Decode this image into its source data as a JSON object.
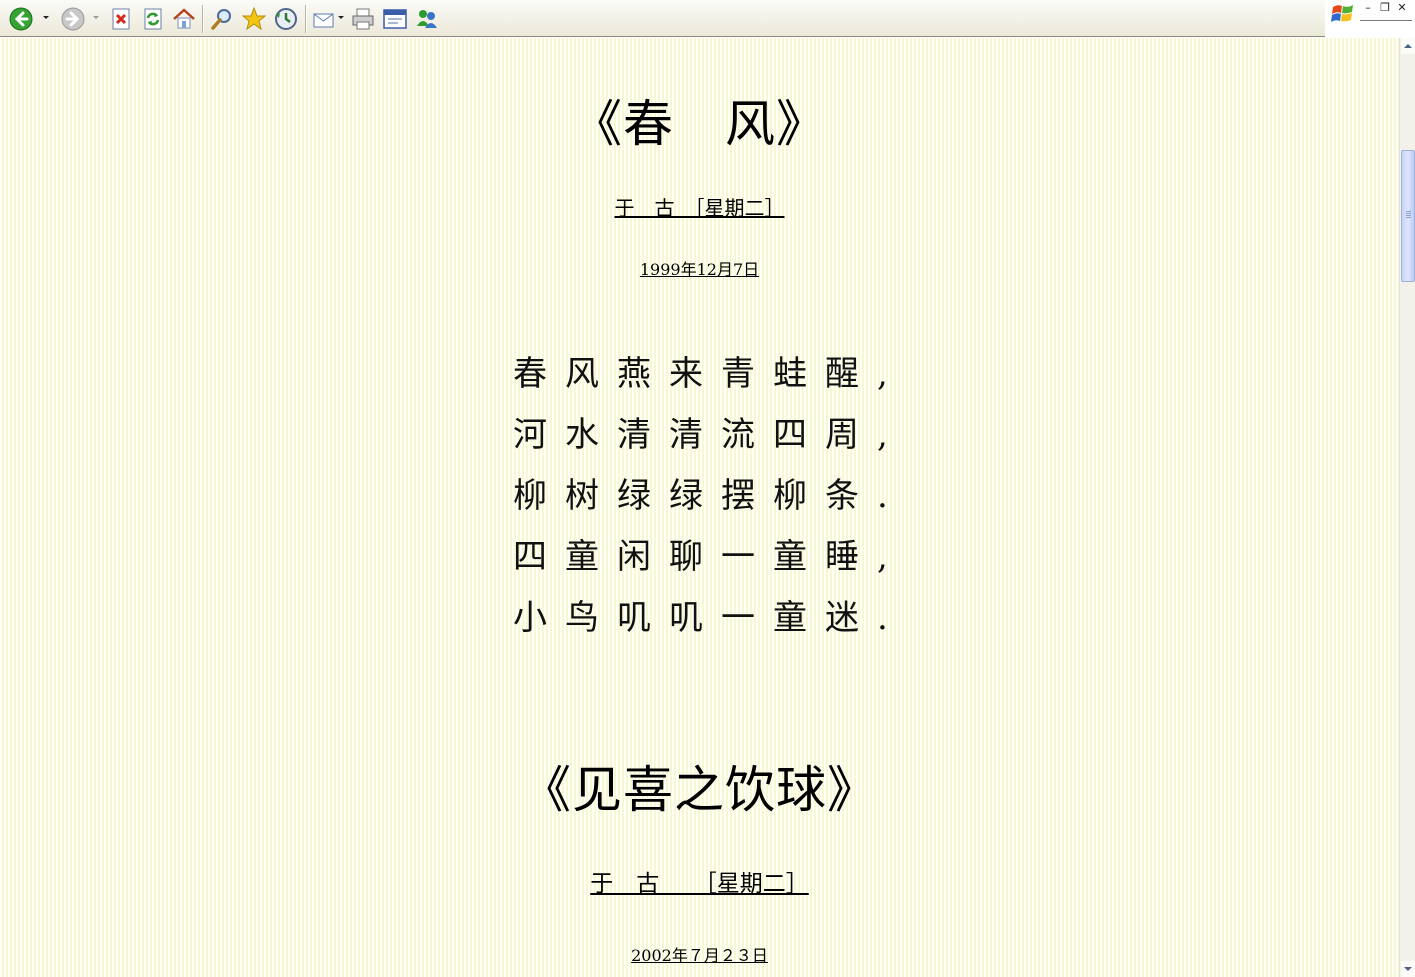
{
  "toolbar": {
    "buttons": [
      {
        "name": "back-button",
        "icon": "back-arrow-icon",
        "color": "#2e9b2e"
      },
      {
        "name": "forward-button",
        "icon": "forward-arrow-icon",
        "color": "#9a9a9a"
      },
      {
        "name": "stop-button",
        "icon": "stop-icon",
        "color": "#d42a1a"
      },
      {
        "name": "refresh-button",
        "icon": "refresh-icon",
        "color": "#2e9b2e"
      },
      {
        "name": "home-button",
        "icon": "home-icon"
      },
      {
        "name": "search-button",
        "icon": "search-icon"
      },
      {
        "name": "favorites-button",
        "icon": "star-icon",
        "color": "#f2c414"
      },
      {
        "name": "history-button",
        "icon": "history-icon"
      },
      {
        "name": "mail-button",
        "icon": "mail-icon"
      },
      {
        "name": "print-button",
        "icon": "printer-icon"
      },
      {
        "name": "edit-button",
        "icon": "edit-icon"
      },
      {
        "name": "messenger-button",
        "icon": "messenger-icon"
      }
    ]
  },
  "window_controls": {
    "minimize": "–",
    "restore": "❐",
    "close": "✕"
  },
  "poem1": {
    "title": "《春　风》",
    "byline": "于　古　［星期二］",
    "date": "1999年12月7日",
    "lines": [
      "春风燕来青蛙醒,",
      "河水清清流四周,",
      "柳树绿绿摆柳条.",
      "四童闲聊一童睡,",
      "小鸟叽叽一童迷."
    ]
  },
  "poem2": {
    "title": "《见喜之饮球》",
    "byline": "于　古　　［星期二］",
    "date": "2002年７月２３日"
  },
  "colors": {
    "page_bg": "#ffffea",
    "page_stripe": "#f7f7d6",
    "scroll_thumb": "#c6d3f7"
  }
}
